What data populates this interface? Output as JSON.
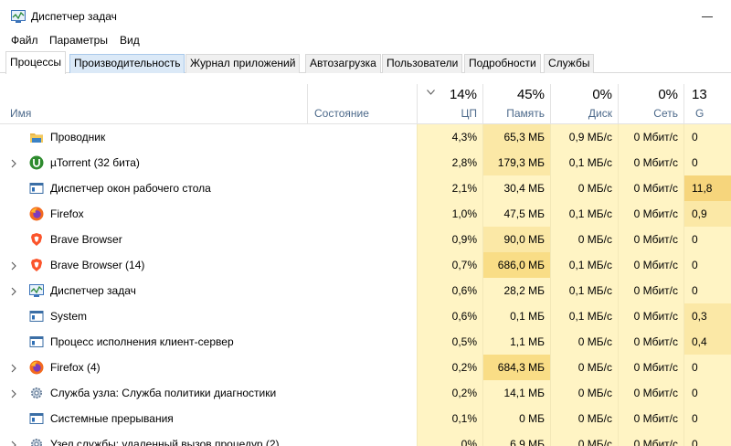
{
  "window": {
    "title": "Диспетчер задач"
  },
  "menu": [
    "Файл",
    "Параметры",
    "Вид"
  ],
  "tabs": [
    "Процессы",
    "Производительность",
    "Журнал приложений",
    "Автозагрузка",
    "Пользователи",
    "Подробности",
    "Службы"
  ],
  "columns": {
    "name": "Имя",
    "status": "Состояние",
    "cpu": {
      "pct": "14%",
      "label": "ЦП"
    },
    "mem": {
      "pct": "45%",
      "label": "Память"
    },
    "disk": {
      "pct": "0%",
      "label": "Диск"
    },
    "net": {
      "pct": "0%",
      "label": "Сеть"
    },
    "gpu": {
      "pct": "13",
      "label": "G"
    }
  },
  "colors": {
    "heat_light": "#fff4c4",
    "heat_mid": "#fbe8a6",
    "heat_strong": "#f9dd86",
    "heat_gpu": "#f6d57c"
  },
  "processes": [
    {
      "name": "Проводник",
      "icon": "folder-icon",
      "expandable": false,
      "cpu": "4,3%",
      "mem": "65,3 МБ",
      "disk": "0,9 МБ/с",
      "net": "0 Мбит/с",
      "gpu": "0"
    },
    {
      "name": "µTorrent (32 бита)",
      "icon": "utorrent-icon",
      "expandable": true,
      "cpu": "2,8%",
      "mem": "179,3 МБ",
      "disk": "0,1 МБ/с",
      "net": "0 Мбит/с",
      "gpu": "0"
    },
    {
      "name": "Диспетчер окон рабочего стола",
      "icon": "window-icon",
      "expandable": false,
      "cpu": "2,1%",
      "mem": "30,4 МБ",
      "disk": "0 МБ/с",
      "net": "0 Мбит/с",
      "gpu": "11,8"
    },
    {
      "name": "Firefox",
      "icon": "firefox-icon",
      "expandable": false,
      "cpu": "1,0%",
      "mem": "47,5 МБ",
      "disk": "0,1 МБ/с",
      "net": "0 Мбит/с",
      "gpu": "0,9"
    },
    {
      "name": "Brave Browser",
      "icon": "brave-icon",
      "expandable": false,
      "cpu": "0,9%",
      "mem": "90,0 МБ",
      "disk": "0 МБ/с",
      "net": "0 Мбит/с",
      "gpu": "0"
    },
    {
      "name": "Brave Browser (14)",
      "icon": "brave-icon",
      "expandable": true,
      "cpu": "0,7%",
      "mem": "686,0 МБ",
      "disk": "0,1 МБ/с",
      "net": "0 Мбит/с",
      "gpu": "0"
    },
    {
      "name": "Диспетчер задач",
      "icon": "taskmgr-icon",
      "expandable": true,
      "cpu": "0,6%",
      "mem": "28,2 МБ",
      "disk": "0,1 МБ/с",
      "net": "0 Мбит/с",
      "gpu": "0"
    },
    {
      "name": "System",
      "icon": "window-icon",
      "expandable": false,
      "cpu": "0,6%",
      "mem": "0,1 МБ",
      "disk": "0,1 МБ/с",
      "net": "0 Мбит/с",
      "gpu": "0,3"
    },
    {
      "name": "Процесс исполнения клиент-сервер",
      "icon": "window-icon",
      "expandable": false,
      "cpu": "0,5%",
      "mem": "1,1 МБ",
      "disk": "0 МБ/с",
      "net": "0 Мбит/с",
      "gpu": "0,4"
    },
    {
      "name": "Firefox (4)",
      "icon": "firefox-icon",
      "expandable": true,
      "cpu": "0,2%",
      "mem": "684,3 МБ",
      "disk": "0 МБ/с",
      "net": "0 Мбит/с",
      "gpu": "0"
    },
    {
      "name": "Служба узла: Служба политики диагностики",
      "icon": "gear-icon",
      "expandable": true,
      "cpu": "0,2%",
      "mem": "14,1 МБ",
      "disk": "0 МБ/с",
      "net": "0 Мбит/с",
      "gpu": "0"
    },
    {
      "name": "Системные прерывания",
      "icon": "window-icon",
      "expandable": false,
      "cpu": "0,1%",
      "mem": "0 МБ",
      "disk": "0 МБ/с",
      "net": "0 Мбит/с",
      "gpu": "0"
    },
    {
      "name": "Узел службы: удаленный вызов процедур (2)",
      "icon": "gear-icon",
      "expandable": true,
      "cpu": "0%",
      "mem": "6,9 МБ",
      "disk": "0 МБ/с",
      "net": "0 Мбит/с",
      "gpu": "0"
    }
  ]
}
